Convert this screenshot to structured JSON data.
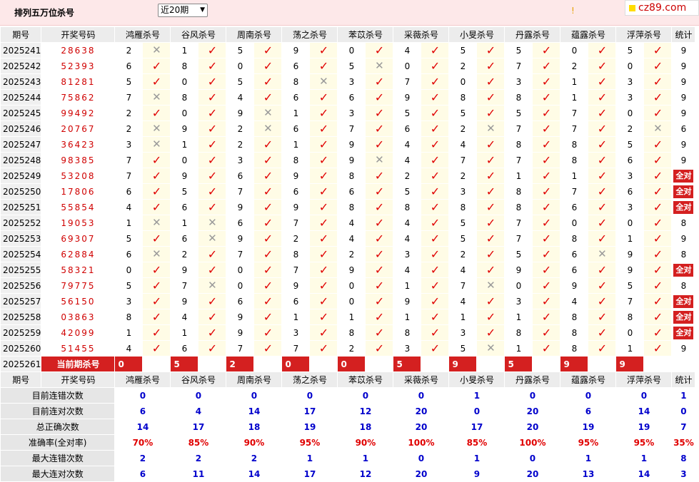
{
  "header": {
    "title": "排列五万位杀号",
    "period_select": "近20期",
    "marker": "!",
    "logo": "cz89.com"
  },
  "columns": [
    "期号",
    "开奖号码",
    "鸿雁杀号",
    "谷风杀号",
    "周南杀号",
    "荡之杀号",
    "苯苡杀号",
    "采薇杀号",
    "小旻杀号",
    "丹露杀号",
    "蕴露杀号",
    "浮萍杀号",
    "统计"
  ],
  "rows": [
    {
      "period": "2025241",
      "number": "28638",
      "kills": [
        [
          "2",
          "x"
        ],
        [
          "1",
          "ok"
        ],
        [
          "5",
          "ok"
        ],
        [
          "9",
          "ok"
        ],
        [
          "0",
          "ok"
        ],
        [
          "4",
          "ok"
        ],
        [
          "5",
          "ok"
        ],
        [
          "5",
          "ok"
        ],
        [
          "0",
          "ok"
        ],
        [
          "5",
          "ok"
        ]
      ],
      "stat": "9"
    },
    {
      "period": "2025242",
      "number": "52393",
      "kills": [
        [
          "6",
          "ok"
        ],
        [
          "8",
          "ok"
        ],
        [
          "0",
          "ok"
        ],
        [
          "6",
          "ok"
        ],
        [
          "5",
          "x"
        ],
        [
          "0",
          "ok"
        ],
        [
          "2",
          "ok"
        ],
        [
          "7",
          "ok"
        ],
        [
          "2",
          "ok"
        ],
        [
          "0",
          "ok"
        ]
      ],
      "stat": "9"
    },
    {
      "period": "2025243",
      "number": "81281",
      "kills": [
        [
          "5",
          "ok"
        ],
        [
          "0",
          "ok"
        ],
        [
          "5",
          "ok"
        ],
        [
          "8",
          "x"
        ],
        [
          "3",
          "ok"
        ],
        [
          "7",
          "ok"
        ],
        [
          "0",
          "ok"
        ],
        [
          "3",
          "ok"
        ],
        [
          "1",
          "ok"
        ],
        [
          "3",
          "ok"
        ]
      ],
      "stat": "9"
    },
    {
      "period": "2025244",
      "number": "75862",
      "kills": [
        [
          "7",
          "x"
        ],
        [
          "8",
          "ok"
        ],
        [
          "4",
          "ok"
        ],
        [
          "6",
          "ok"
        ],
        [
          "6",
          "ok"
        ],
        [
          "9",
          "ok"
        ],
        [
          "8",
          "ok"
        ],
        [
          "8",
          "ok"
        ],
        [
          "1",
          "ok"
        ],
        [
          "3",
          "ok"
        ]
      ],
      "stat": "9"
    },
    {
      "period": "2025245",
      "number": "99492",
      "kills": [
        [
          "2",
          "ok"
        ],
        [
          "0",
          "ok"
        ],
        [
          "9",
          "x"
        ],
        [
          "1",
          "ok"
        ],
        [
          "3",
          "ok"
        ],
        [
          "5",
          "ok"
        ],
        [
          "5",
          "ok"
        ],
        [
          "5",
          "ok"
        ],
        [
          "7",
          "ok"
        ],
        [
          "0",
          "ok"
        ]
      ],
      "stat": "9"
    },
    {
      "period": "2025246",
      "number": "20767",
      "kills": [
        [
          "2",
          "x"
        ],
        [
          "9",
          "ok"
        ],
        [
          "2",
          "x"
        ],
        [
          "6",
          "ok"
        ],
        [
          "7",
          "ok"
        ],
        [
          "6",
          "ok"
        ],
        [
          "2",
          "x"
        ],
        [
          "7",
          "ok"
        ],
        [
          "7",
          "ok"
        ],
        [
          "2",
          "x"
        ]
      ],
      "stat": "6"
    },
    {
      "period": "2025247",
      "number": "36423",
      "kills": [
        [
          "3",
          "x"
        ],
        [
          "1",
          "ok"
        ],
        [
          "2",
          "ok"
        ],
        [
          "1",
          "ok"
        ],
        [
          "9",
          "ok"
        ],
        [
          "4",
          "ok"
        ],
        [
          "4",
          "ok"
        ],
        [
          "8",
          "ok"
        ],
        [
          "8",
          "ok"
        ],
        [
          "5",
          "ok"
        ]
      ],
      "stat": "9"
    },
    {
      "period": "2025248",
      "number": "98385",
      "kills": [
        [
          "7",
          "ok"
        ],
        [
          "0",
          "ok"
        ],
        [
          "3",
          "ok"
        ],
        [
          "8",
          "ok"
        ],
        [
          "9",
          "x"
        ],
        [
          "4",
          "ok"
        ],
        [
          "7",
          "ok"
        ],
        [
          "7",
          "ok"
        ],
        [
          "8",
          "ok"
        ],
        [
          "6",
          "ok"
        ]
      ],
      "stat": "9"
    },
    {
      "period": "2025249",
      "number": "53208",
      "kills": [
        [
          "7",
          "ok"
        ],
        [
          "9",
          "ok"
        ],
        [
          "6",
          "ok"
        ],
        [
          "9",
          "ok"
        ],
        [
          "8",
          "ok"
        ],
        [
          "2",
          "ok"
        ],
        [
          "2",
          "ok"
        ],
        [
          "1",
          "ok"
        ],
        [
          "1",
          "ok"
        ],
        [
          "3",
          "ok"
        ]
      ],
      "stat": "全对"
    },
    {
      "period": "2025250",
      "number": "17806",
      "kills": [
        [
          "6",
          "ok"
        ],
        [
          "5",
          "ok"
        ],
        [
          "7",
          "ok"
        ],
        [
          "6",
          "ok"
        ],
        [
          "6",
          "ok"
        ],
        [
          "5",
          "ok"
        ],
        [
          "3",
          "ok"
        ],
        [
          "8",
          "ok"
        ],
        [
          "7",
          "ok"
        ],
        [
          "6",
          "ok"
        ]
      ],
      "stat": "全对"
    },
    {
      "period": "2025251",
      "number": "55854",
      "kills": [
        [
          "4",
          "ok"
        ],
        [
          "6",
          "ok"
        ],
        [
          "9",
          "ok"
        ],
        [
          "9",
          "ok"
        ],
        [
          "8",
          "ok"
        ],
        [
          "8",
          "ok"
        ],
        [
          "8",
          "ok"
        ],
        [
          "8",
          "ok"
        ],
        [
          "6",
          "ok"
        ],
        [
          "3",
          "ok"
        ]
      ],
      "stat": "全对"
    },
    {
      "period": "2025252",
      "number": "19053",
      "kills": [
        [
          "1",
          "x"
        ],
        [
          "1",
          "x"
        ],
        [
          "6",
          "ok"
        ],
        [
          "7",
          "ok"
        ],
        [
          "4",
          "ok"
        ],
        [
          "4",
          "ok"
        ],
        [
          "5",
          "ok"
        ],
        [
          "7",
          "ok"
        ],
        [
          "0",
          "ok"
        ],
        [
          "0",
          "ok"
        ]
      ],
      "stat": "8"
    },
    {
      "period": "2025253",
      "number": "69307",
      "kills": [
        [
          "5",
          "ok"
        ],
        [
          "6",
          "x"
        ],
        [
          "9",
          "ok"
        ],
        [
          "2",
          "ok"
        ],
        [
          "4",
          "ok"
        ],
        [
          "4",
          "ok"
        ],
        [
          "5",
          "ok"
        ],
        [
          "7",
          "ok"
        ],
        [
          "8",
          "ok"
        ],
        [
          "1",
          "ok"
        ]
      ],
      "stat": "9"
    },
    {
      "period": "2025254",
      "number": "62884",
      "kills": [
        [
          "6",
          "x"
        ],
        [
          "2",
          "ok"
        ],
        [
          "7",
          "ok"
        ],
        [
          "8",
          "ok"
        ],
        [
          "2",
          "ok"
        ],
        [
          "3",
          "ok"
        ],
        [
          "2",
          "ok"
        ],
        [
          "5",
          "ok"
        ],
        [
          "6",
          "x"
        ],
        [
          "9",
          "ok"
        ]
      ],
      "stat": "8"
    },
    {
      "period": "2025255",
      "number": "58321",
      "kills": [
        [
          "0",
          "ok"
        ],
        [
          "9",
          "ok"
        ],
        [
          "0",
          "ok"
        ],
        [
          "7",
          "ok"
        ],
        [
          "9",
          "ok"
        ],
        [
          "4",
          "ok"
        ],
        [
          "4",
          "ok"
        ],
        [
          "9",
          "ok"
        ],
        [
          "6",
          "ok"
        ],
        [
          "9",
          "ok"
        ]
      ],
      "stat": "全对"
    },
    {
      "period": "2025256",
      "number": "79775",
      "kills": [
        [
          "5",
          "ok"
        ],
        [
          "7",
          "x"
        ],
        [
          "0",
          "ok"
        ],
        [
          "9",
          "ok"
        ],
        [
          "0",
          "ok"
        ],
        [
          "1",
          "ok"
        ],
        [
          "7",
          "x"
        ],
        [
          "0",
          "ok"
        ],
        [
          "9",
          "ok"
        ],
        [
          "5",
          "ok"
        ]
      ],
      "stat": "8"
    },
    {
      "period": "2025257",
      "number": "56150",
      "kills": [
        [
          "3",
          "ok"
        ],
        [
          "9",
          "ok"
        ],
        [
          "6",
          "ok"
        ],
        [
          "6",
          "ok"
        ],
        [
          "0",
          "ok"
        ],
        [
          "9",
          "ok"
        ],
        [
          "4",
          "ok"
        ],
        [
          "3",
          "ok"
        ],
        [
          "4",
          "ok"
        ],
        [
          "7",
          "ok"
        ]
      ],
      "stat": "全对"
    },
    {
      "period": "2025258",
      "number": "03863",
      "kills": [
        [
          "8",
          "ok"
        ],
        [
          "4",
          "ok"
        ],
        [
          "9",
          "ok"
        ],
        [
          "1",
          "ok"
        ],
        [
          "1",
          "ok"
        ],
        [
          "1",
          "ok"
        ],
        [
          "1",
          "ok"
        ],
        [
          "1",
          "ok"
        ],
        [
          "8",
          "ok"
        ],
        [
          "8",
          "ok"
        ]
      ],
      "stat": "全对"
    },
    {
      "period": "2025259",
      "number": "42099",
      "kills": [
        [
          "1",
          "ok"
        ],
        [
          "1",
          "ok"
        ],
        [
          "9",
          "ok"
        ],
        [
          "3",
          "ok"
        ],
        [
          "8",
          "ok"
        ],
        [
          "8",
          "ok"
        ],
        [
          "3",
          "ok"
        ],
        [
          "8",
          "ok"
        ],
        [
          "8",
          "ok"
        ],
        [
          "0",
          "ok"
        ]
      ],
      "stat": "全对"
    },
    {
      "period": "2025260",
      "number": "51455",
      "kills": [
        [
          "4",
          "ok"
        ],
        [
          "6",
          "ok"
        ],
        [
          "7",
          "ok"
        ],
        [
          "7",
          "ok"
        ],
        [
          "2",
          "ok"
        ],
        [
          "3",
          "ok"
        ],
        [
          "5",
          "x"
        ],
        [
          "1",
          "ok"
        ],
        [
          "8",
          "ok"
        ],
        [
          "1",
          "ok"
        ]
      ],
      "stat": "9"
    }
  ],
  "current": {
    "period": "2025261",
    "label": "当前期杀号",
    "kills": [
      "0",
      "5",
      "2",
      "0",
      "0",
      "5",
      "9",
      "5",
      "9",
      "9"
    ]
  },
  "stats": [
    {
      "label": "目前连错次数",
      "values": [
        "0",
        "0",
        "0",
        "0",
        "0",
        "0",
        "1",
        "0",
        "0",
        "0"
      ],
      "stat": "1",
      "red": false
    },
    {
      "label": "目前连对次数",
      "values": [
        "6",
        "4",
        "14",
        "17",
        "12",
        "20",
        "0",
        "20",
        "6",
        "14"
      ],
      "stat": "0",
      "red": false
    },
    {
      "label": "总正确次数",
      "values": [
        "14",
        "17",
        "18",
        "19",
        "18",
        "20",
        "17",
        "20",
        "19",
        "19"
      ],
      "stat": "7",
      "red": false
    },
    {
      "label": "准确率(全对率)",
      "values": [
        "70%",
        "85%",
        "90%",
        "95%",
        "90%",
        "100%",
        "85%",
        "100%",
        "95%",
        "95%"
      ],
      "stat": "35%",
      "red": true
    },
    {
      "label": "最大连错次数",
      "values": [
        "2",
        "2",
        "2",
        "1",
        "1",
        "0",
        "1",
        "0",
        "1",
        "1"
      ],
      "stat": "8",
      "red": false
    },
    {
      "label": "最大连对次数",
      "values": [
        "6",
        "11",
        "14",
        "17",
        "12",
        "20",
        "9",
        "20",
        "13",
        "14"
      ],
      "stat": "3",
      "red": false
    }
  ],
  "symbols": {
    "ok": "✓",
    "x": "✕"
  }
}
